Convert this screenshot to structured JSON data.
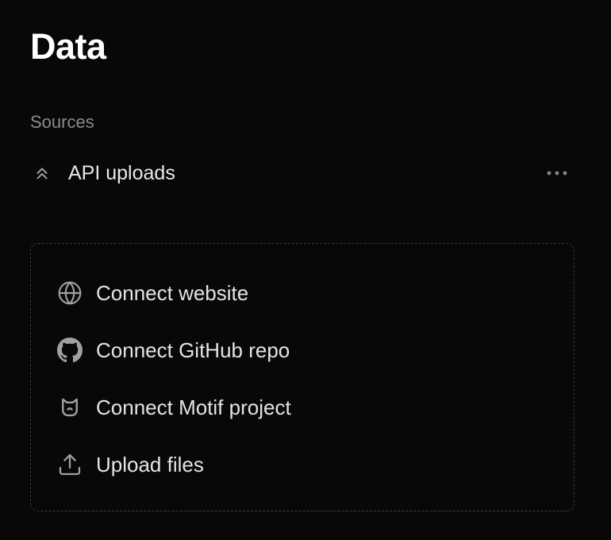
{
  "header": {
    "title": "Data"
  },
  "sources": {
    "label": "Sources",
    "items": [
      {
        "label": "API uploads",
        "icon": "chevrons-up-icon",
        "menu_icon": "more-horizontal-icon"
      }
    ]
  },
  "connect": {
    "items": [
      {
        "label": "Connect website",
        "icon": "globe-icon"
      },
      {
        "label": "Connect GitHub repo",
        "icon": "github-icon"
      },
      {
        "label": "Connect Motif project",
        "icon": "motif-icon"
      },
      {
        "label": "Upload files",
        "icon": "upload-icon"
      }
    ]
  },
  "colors": {
    "background": "#080808",
    "text_primary": "#e6e6e6",
    "text_muted": "#8b8b8b",
    "icon": "#a0a0a0",
    "dashed_border": "#3a3a3a"
  }
}
